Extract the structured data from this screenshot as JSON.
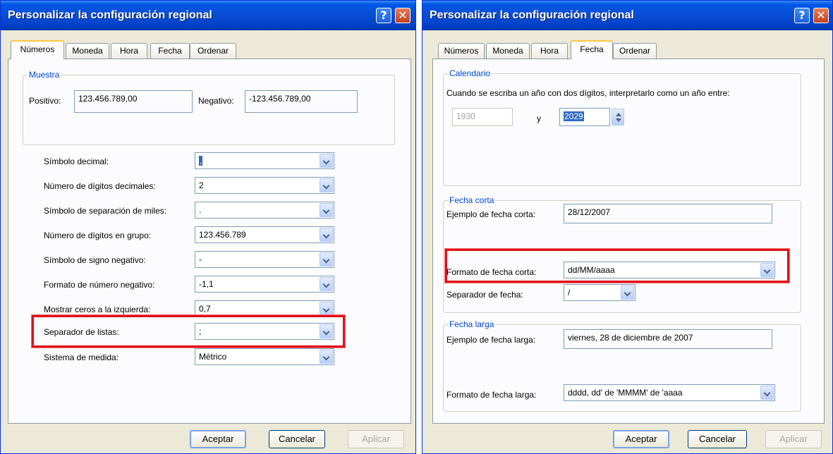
{
  "left_window": {
    "title": "Personalizar la configuración regional",
    "tabs": [
      "Números",
      "Moneda",
      "Hora",
      "Fecha",
      "Ordenar"
    ],
    "active_tab": "Números",
    "sample": {
      "group_label": "Muestra",
      "positive_label": "Positivo:",
      "positive_value": "123.456.789,00",
      "negative_label": "Negativo:",
      "negative_value": "-123.456.789,00"
    },
    "settings": [
      {
        "label": "Símbolo decimal:",
        "value": ","
      },
      {
        "label": "Número de dígitos decimales:",
        "value": "2"
      },
      {
        "label": "Símbolo de separación de miles:",
        "value": "."
      },
      {
        "label": "Número de dígitos en grupo:",
        "value": "123.456.789"
      },
      {
        "label": "Símbolo de signo negativo:",
        "value": "-"
      },
      {
        "label": "Formato de número negativo:",
        "value": "-1,1"
      },
      {
        "label": "Mostrar ceros a la izquierda:",
        "value": "0,7"
      },
      {
        "label": "Separador de listas:",
        "value": ";"
      },
      {
        "label": "Sistema de medida:",
        "value": "Métrico"
      }
    ],
    "buttons": {
      "ok": "Aceptar",
      "cancel": "Cancelar",
      "apply": "Aplicar"
    }
  },
  "right_window": {
    "title": "Personalizar la configuración regional",
    "tabs": [
      "Números",
      "Moneda",
      "Hora",
      "Fecha",
      "Ordenar"
    ],
    "active_tab": "Fecha",
    "calendar": {
      "group_label": "Calendario",
      "description": "Cuando se escriba un año con dos dígitos, interpretarlo como un año entre:",
      "from_year": "1930",
      "and_label": "y",
      "to_year": "2029"
    },
    "short_date": {
      "group_label": "Fecha corta",
      "example_label": "Ejemplo de fecha corta:",
      "example_value": "28/12/2007",
      "format_label": "Formato de fecha corta:",
      "format_value": "dd/MM/aaaa",
      "separator_label": "Separador de fecha:",
      "separator_value": "/"
    },
    "long_date": {
      "group_label": "Fecha larga",
      "example_label": "Ejemplo de fecha larga:",
      "example_value": "viernes, 28 de diciembre de 2007",
      "format_label": "Formato de fecha larga:",
      "format_value": "dddd, dd' de 'MMMM' de 'aaaa"
    },
    "buttons": {
      "ok": "Aceptar",
      "cancel": "Cancelar",
      "apply": "Aplicar"
    }
  },
  "colors": {
    "highlight": "#e0101a",
    "title_bar": "#0a4ed6",
    "group_label": "#0046d5"
  }
}
